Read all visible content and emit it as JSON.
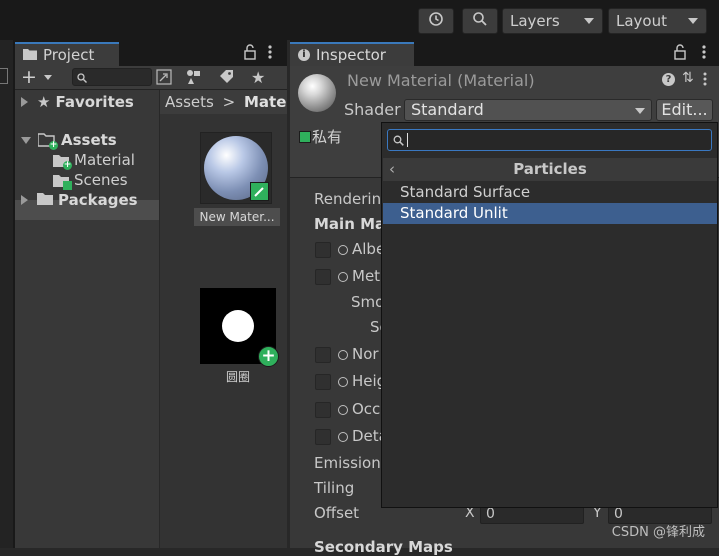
{
  "toolbar": {
    "layers_label": "Layers",
    "layout_label": "Layout"
  },
  "project": {
    "tab_label": "Project",
    "tree": [
      {
        "label": "Favorites"
      },
      {
        "label": "Assets"
      },
      {
        "label": "Material"
      },
      {
        "label": "Scenes"
      },
      {
        "label": "Packages"
      }
    ],
    "breadcrumb": {
      "root": "Assets",
      "separator": ">",
      "current": "Materi"
    },
    "assets": [
      {
        "name": "New Mater..."
      },
      {
        "name": "圆圈"
      }
    ]
  },
  "inspector": {
    "tab_label": "Inspector",
    "material_title": "New Material (Material)",
    "shader_label": "Shader",
    "shader_value": "Standard",
    "edit_button": "Edit...",
    "private_label": "私有",
    "rows": {
      "rendering": "Renderin",
      "main_maps": "Main Ma",
      "albedo": "Albe",
      "metallic": "Met",
      "smoothness": "Smo",
      "source": "So",
      "normal": "Nor",
      "height": "Heig",
      "occlusion": "Occ",
      "detail": "Deta",
      "emission": "Emission",
      "tiling": "Tiling",
      "offset": "Offset",
      "secondary_maps": "Secondary Maps"
    },
    "offset": {
      "x_label": "X",
      "x_value": "0",
      "y_label": "Y",
      "y_value": "0"
    }
  },
  "shader_popup": {
    "search_value": "",
    "header": "Particles",
    "items": [
      {
        "label": "Standard Surface",
        "selected": false
      },
      {
        "label": "Standard Unlit",
        "selected": true
      }
    ]
  },
  "watermark": "CSDN @锋利成",
  "colors": {
    "accent_blue": "#3a79bb",
    "selection_blue": "#3d5f8f",
    "badge_green": "#2fb05c"
  }
}
